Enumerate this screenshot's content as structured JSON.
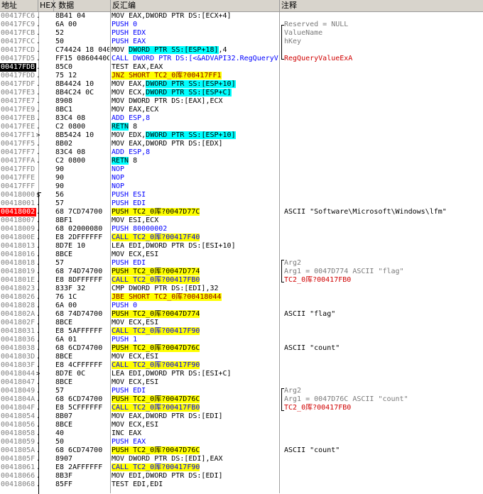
{
  "headers": {
    "addr": "地址",
    "hex": "HEX 数据",
    "asm": "反汇编",
    "comment": "注释"
  },
  "rows": [
    {
      "addr": "00417FC6",
      "mk": ".",
      "hex": "8B41 04",
      "asm": "MOV EAX,DWORD PTR DS:[ECX+4]",
      "cmt": ""
    },
    {
      "addr": "00417FC9",
      "mk": ".",
      "hex": "6A 00",
      "asm": "PUSH 0",
      "cmt": "Reserved = NULL"
    },
    {
      "addr": "00417FCB",
      "mk": ".",
      "hex": "52",
      "asm": "PUSH EDX",
      "cmt": "ValueName"
    },
    {
      "addr": "00417FCC",
      "mk": ".",
      "hex": "50",
      "asm": "PUSH EAX",
      "cmt": "hKey"
    },
    {
      "addr": "00417FCD",
      "mk": ".",
      "hex": "C74424 18 040",
      "asm": "MOV DWORD PTR SS:[ESP+18],4",
      "cmt": ""
    },
    {
      "addr": "00417FD5",
      "mk": ".",
      "hex": "FF15 0860440C",
      "asm": "CALL DWORD PTR DS:[<&ADVAPI32.RegQueryV",
      "cmt": "RegQueryValueExA"
    },
    {
      "addr": "00417FDB",
      "mk": ".",
      "hex": "85C0",
      "asm": "TEST EAX,EAX",
      "cmt": ""
    },
    {
      "addr": "00417FDD",
      "mk": ".",
      "hex": "75 12",
      "asm": "JNZ SHORT TC2_0库?00417FF1",
      "cmt": ""
    },
    {
      "addr": "00417FDF",
      "mk": ".",
      "hex": "8B4424 10",
      "asm": "MOV EAX,DWORD PTR SS:[ESP+10]",
      "cmt": ""
    },
    {
      "addr": "00417FE3",
      "mk": ".",
      "hex": "8B4C24 0C",
      "asm": "MOV ECX,DWORD PTR SS:[ESP+C]",
      "cmt": ""
    },
    {
      "addr": "00417FE7",
      "mk": ".",
      "hex": "8908",
      "asm": "MOV DWORD PTR DS:[EAX],ECX",
      "cmt": ""
    },
    {
      "addr": "00417FE9",
      "mk": ".",
      "hex": "8BC1",
      "asm": "MOV EAX,ECX",
      "cmt": ""
    },
    {
      "addr": "00417FEB",
      "mk": ".",
      "hex": "83C4 08",
      "asm": "ADD ESP,8",
      "cmt": ""
    },
    {
      "addr": "00417FEE",
      "mk": ".",
      "hex": "C2 0800",
      "asm": "RETN 8",
      "cmt": ""
    },
    {
      "addr": "00417FF1",
      "mk": ">",
      "hex": "8B5424 10",
      "asm": "MOV EDX,DWORD PTR SS:[ESP+10]",
      "cmt": ""
    },
    {
      "addr": "00417FF5",
      "mk": ".",
      "hex": "8B02",
      "asm": "MOV EAX,DWORD PTR DS:[EDX]",
      "cmt": ""
    },
    {
      "addr": "00417FF7",
      "mk": ".",
      "hex": "83C4 08",
      "asm": "ADD ESP,8",
      "cmt": ""
    },
    {
      "addr": "00417FFA",
      "mk": ".",
      "hex": "C2 0800",
      "asm": "RETN 8",
      "cmt": ""
    },
    {
      "addr": "00417FFD",
      "mk": "",
      "hex": "90",
      "asm": "NOP",
      "cmt": ""
    },
    {
      "addr": "00417FFE",
      "mk": "",
      "hex": "90",
      "asm": "NOP",
      "cmt": ""
    },
    {
      "addr": "00417FFF",
      "mk": "",
      "hex": "90",
      "asm": "NOP",
      "cmt": ""
    },
    {
      "addr": "00418000",
      "mk": "$",
      "hex": "56",
      "asm": "PUSH ESI",
      "cmt": ""
    },
    {
      "addr": "00418001",
      "mk": ".",
      "hex": "57",
      "asm": "PUSH EDI",
      "cmt": ""
    },
    {
      "addr": "00418002",
      "mk": ".",
      "hex": "68 7CD74700",
      "asm": "PUSH TC2_0库?0047D77C",
      "cmt": "ASCII \"Software\\Microsoft\\Windows\\lfm\""
    },
    {
      "addr": "00418007",
      "mk": ".",
      "hex": "8BF1",
      "asm": "MOV ESI,ECX",
      "cmt": ""
    },
    {
      "addr": "00418009",
      "mk": ".",
      "hex": "68 02000080",
      "asm": "PUSH 80000002",
      "cmt": ""
    },
    {
      "addr": "0041800E",
      "mk": ".",
      "hex": "E8 2DFFFFFF",
      "asm": "CALL TC2_0库?00417F40",
      "cmt": ""
    },
    {
      "addr": "00418013",
      "mk": ".",
      "hex": "8D7E 10",
      "asm": "LEA EDI,DWORD PTR DS:[ESI+10]",
      "cmt": ""
    },
    {
      "addr": "00418016",
      "mk": ".",
      "hex": "8BCE",
      "asm": "MOV ECX,ESI",
      "cmt": ""
    },
    {
      "addr": "00418018",
      "mk": ".",
      "hex": "57",
      "asm": "PUSH EDI",
      "cmt": "Arg2"
    },
    {
      "addr": "00418019",
      "mk": ".",
      "hex": "68 74D74700",
      "asm": "PUSH TC2_0库?0047D774",
      "cmt": "Arg1 = 0047D774 ASCII \"flag\""
    },
    {
      "addr": "0041801E",
      "mk": ".",
      "hex": "E8 8DFFFFFF",
      "asm": "CALL TC2_0库?00417FB0",
      "cmt": "TC2_0库?00417FB0"
    },
    {
      "addr": "00418023",
      "mk": ".",
      "hex": "833F 32",
      "asm": "CMP DWORD PTR DS:[EDI],32",
      "cmt": ""
    },
    {
      "addr": "00418026",
      "mk": ".",
      "hex": "76 1C",
      "asm": "JBE SHORT TC2_0库?00418044",
      "cmt": ""
    },
    {
      "addr": "00418028",
      "mk": ".",
      "hex": "6A 00",
      "asm": "PUSH 0",
      "cmt": ""
    },
    {
      "addr": "0041802A",
      "mk": ".",
      "hex": "68 74D74700",
      "asm": "PUSH TC2_0库?0047D774",
      "cmt": "ASCII \"flag\""
    },
    {
      "addr": "0041802F",
      "mk": ".",
      "hex": "8BCE",
      "asm": "MOV ECX,ESI",
      "cmt": ""
    },
    {
      "addr": "00418031",
      "mk": ".",
      "hex": "E8 5AFFFFFF",
      "asm": "CALL TC2_0库?00417F90",
      "cmt": ""
    },
    {
      "addr": "00418036",
      "mk": ".",
      "hex": "6A 01",
      "asm": "PUSH 1",
      "cmt": ""
    },
    {
      "addr": "00418038",
      "mk": ".",
      "hex": "68 6CD74700",
      "asm": "PUSH TC2_0库?0047D76C",
      "cmt": "ASCII \"count\""
    },
    {
      "addr": "0041803D",
      "mk": ".",
      "hex": "8BCE",
      "asm": "MOV ECX,ESI",
      "cmt": ""
    },
    {
      "addr": "0041803F",
      "mk": ".",
      "hex": "E8 4CFFFFFF",
      "asm": "CALL TC2_0库?00417F90",
      "cmt": ""
    },
    {
      "addr": "00418044",
      "mk": ">",
      "hex": "8D7E 0C",
      "asm": "LEA EDI,DWORD PTR DS:[ESI+C]",
      "cmt": ""
    },
    {
      "addr": "00418047",
      "mk": ".",
      "hex": "8BCE",
      "asm": "MOV ECX,ESI",
      "cmt": ""
    },
    {
      "addr": "00418049",
      "mk": ".",
      "hex": "57",
      "asm": "PUSH EDI",
      "cmt": "Arg2"
    },
    {
      "addr": "0041804A",
      "mk": ".",
      "hex": "68 6CD74700",
      "asm": "PUSH TC2_0库?0047D76C",
      "cmt": "Arg1 = 0047D76C ASCII \"count\""
    },
    {
      "addr": "0041804F",
      "mk": ".",
      "hex": "E8 5CFFFFFF",
      "asm": "CALL TC2_0库?00417FB0",
      "cmt": "TC2_0库?00417FB0"
    },
    {
      "addr": "00418054",
      "mk": ".",
      "hex": "8B07",
      "asm": "MOV EAX,DWORD PTR DS:[EDI]",
      "cmt": ""
    },
    {
      "addr": "00418056",
      "mk": ".",
      "hex": "8BCE",
      "asm": "MOV ECX,ESI",
      "cmt": ""
    },
    {
      "addr": "00418058",
      "mk": ".",
      "hex": "40",
      "asm": "INC EAX",
      "cmt": ""
    },
    {
      "addr": "00418059",
      "mk": ".",
      "hex": "50",
      "asm": "PUSH EAX",
      "cmt": ""
    },
    {
      "addr": "0041805A",
      "mk": ".",
      "hex": "68 6CD74700",
      "asm": "PUSH TC2_0库?0047D76C",
      "cmt": "ASCII \"count\""
    },
    {
      "addr": "0041805F",
      "mk": ".",
      "hex": "8907",
      "asm": "MOV DWORD PTR DS:[EDI],EAX",
      "cmt": ""
    },
    {
      "addr": "00418061",
      "mk": ".",
      "hex": "E8 2AFFFFFF",
      "asm": "CALL TC2_0库?00417F90",
      "cmt": ""
    },
    {
      "addr": "00418066",
      "mk": ".",
      "hex": "8B3F",
      "asm": "MOV EDI,DWORD PTR DS:[EDI]",
      "cmt": ""
    },
    {
      "addr": "00418068",
      "mk": ".",
      "hex": "85FF",
      "asm": "TEST EDI,EDI",
      "cmt": ""
    }
  ]
}
